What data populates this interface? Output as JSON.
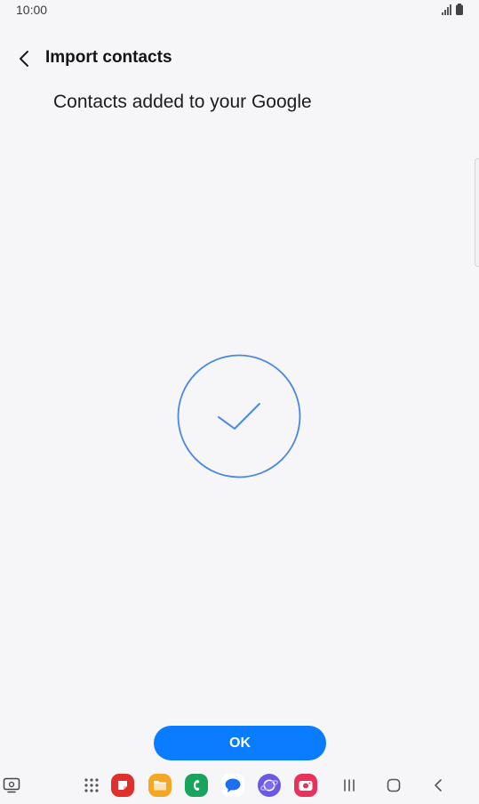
{
  "status_bar": {
    "time": "10:00",
    "signal_icon": "signal-icon",
    "battery_icon": "battery-icon"
  },
  "header": {
    "title": "Import contacts",
    "back_icon": "chevron-left-icon"
  },
  "main": {
    "message": "Contacts added to your Google",
    "success_icon": "check-circle-icon",
    "accent_color": "#4a87e0"
  },
  "footer": {
    "ok_label": "OK",
    "button_color": "#0a7cff"
  },
  "nav_bar": {
    "apps": [
      {
        "name": "app-drawer-icon"
      },
      {
        "name": "notes-app-icon",
        "color": "#e0302c"
      },
      {
        "name": "files-app-icon",
        "color": "#f5a623"
      },
      {
        "name": "phone-app-icon",
        "color": "#1aa35a"
      },
      {
        "name": "messages-app-icon",
        "color": "#1e6ff0"
      },
      {
        "name": "internet-app-icon",
        "color": "#6b58e6"
      },
      {
        "name": "camera-app-icon",
        "color": "#e8315b"
      }
    ],
    "recents_icon": "recents-icon",
    "home_icon": "home-icon",
    "back_icon": "nav-back-icon"
  }
}
